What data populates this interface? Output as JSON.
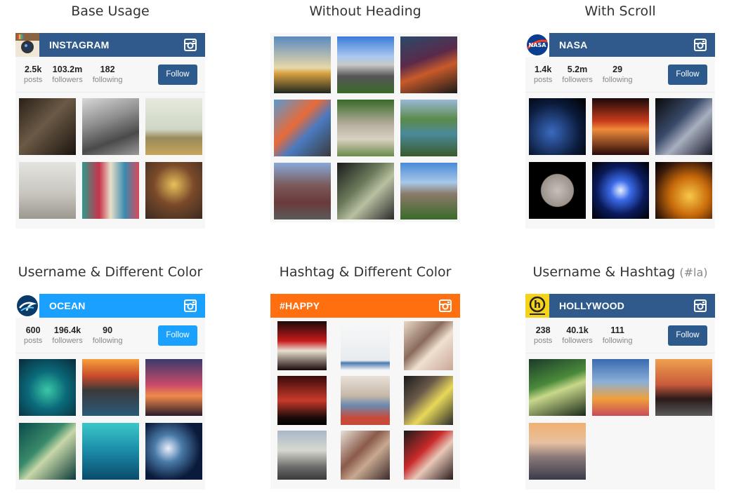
{
  "titles": {
    "base": "Base Usage",
    "noheading": "Without Heading",
    "scroll": "With Scroll",
    "username_color": "Username & Different Color",
    "hashtag_color": "Hashtag & Different Color",
    "username_hashtag": "Username & Hashtag",
    "username_hashtag_suffix": "(#la)"
  },
  "colors": {
    "dark_blue": "#305a8c",
    "ocean_blue": "#1aa1ff",
    "orange": "#ff6f10",
    "button_dark": "#2d5a8d",
    "button_light": "#1aa1ff"
  },
  "widgets": {
    "base": {
      "name": "INSTAGRAM",
      "avatar": "instagram-logo-icon",
      "posts": "2.5k",
      "followers": "103.2m",
      "following": "182",
      "follow": "Follow",
      "posts_label": "posts",
      "followers_label": "followers",
      "following_label": "following"
    },
    "scroll": {
      "name": "NASA",
      "avatar": "nasa-logo-icon",
      "posts": "1.4k",
      "followers": "5.2m",
      "following": "29",
      "follow": "Follow",
      "posts_label": "posts",
      "followers_label": "followers",
      "following_label": "following"
    },
    "ocean": {
      "name": "OCEAN",
      "avatar": "ocean-logo-icon",
      "posts": "600",
      "followers": "196.4k",
      "following": "90",
      "follow": "Follow",
      "posts_label": "posts",
      "followers_label": "followers",
      "following_label": "following"
    },
    "happy": {
      "name": "#HAPPY"
    },
    "hollywood": {
      "name": "HOLLYWOOD",
      "avatar": "hollywood-logo-icon",
      "posts": "238",
      "followers": "40.1k",
      "following": "111",
      "follow": "Follow",
      "posts_label": "posts",
      "followers_label": "followers",
      "following_label": "following"
    }
  }
}
